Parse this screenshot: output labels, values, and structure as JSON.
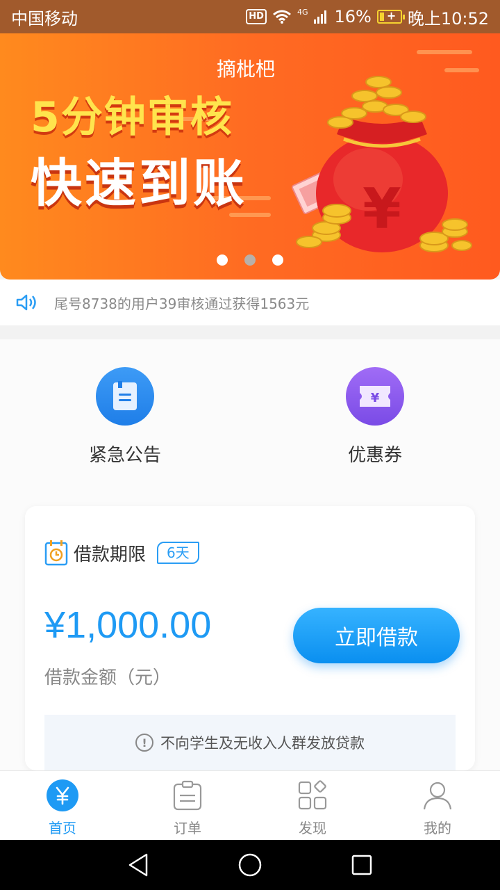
{
  "status_bar": {
    "carrier": "中国移动",
    "hd": "HD",
    "network": "4G",
    "battery": "16%",
    "time": "晚上10:52"
  },
  "banner": {
    "brand": "摘枇杷",
    "line1": "5分钟审核",
    "line2": "快速到账",
    "currency_symbol": "¥",
    "dots_total": 3,
    "active_dot": 1
  },
  "notice": {
    "text": "尾号8738的用户39审核通过获得1563元"
  },
  "quick_actions": [
    {
      "label": "紧急公告",
      "icon": "notice-doc-icon",
      "color": "#2f8bef"
    },
    {
      "label": "优惠券",
      "icon": "coupon-icon",
      "color": "#8a5bf0"
    }
  ],
  "loan_card": {
    "period_label": "借款期限",
    "period_value": "6天",
    "amount": "¥1,000.00",
    "amount_label": "借款金额（元）",
    "button_label": "立即借款",
    "warning": "不向学生及无收入人群发放贷款"
  },
  "tabs": [
    {
      "label": "首页",
      "icon": "home-yen-icon",
      "active": true
    },
    {
      "label": "订单",
      "icon": "order-icon",
      "active": false
    },
    {
      "label": "发现",
      "icon": "discover-icon",
      "active": false
    },
    {
      "label": "我的",
      "icon": "profile-icon",
      "active": false
    }
  ],
  "colors": {
    "accent": "#1e9af4",
    "banner_orange": "#ff6b22",
    "status_bar": "#a15a2c"
  }
}
